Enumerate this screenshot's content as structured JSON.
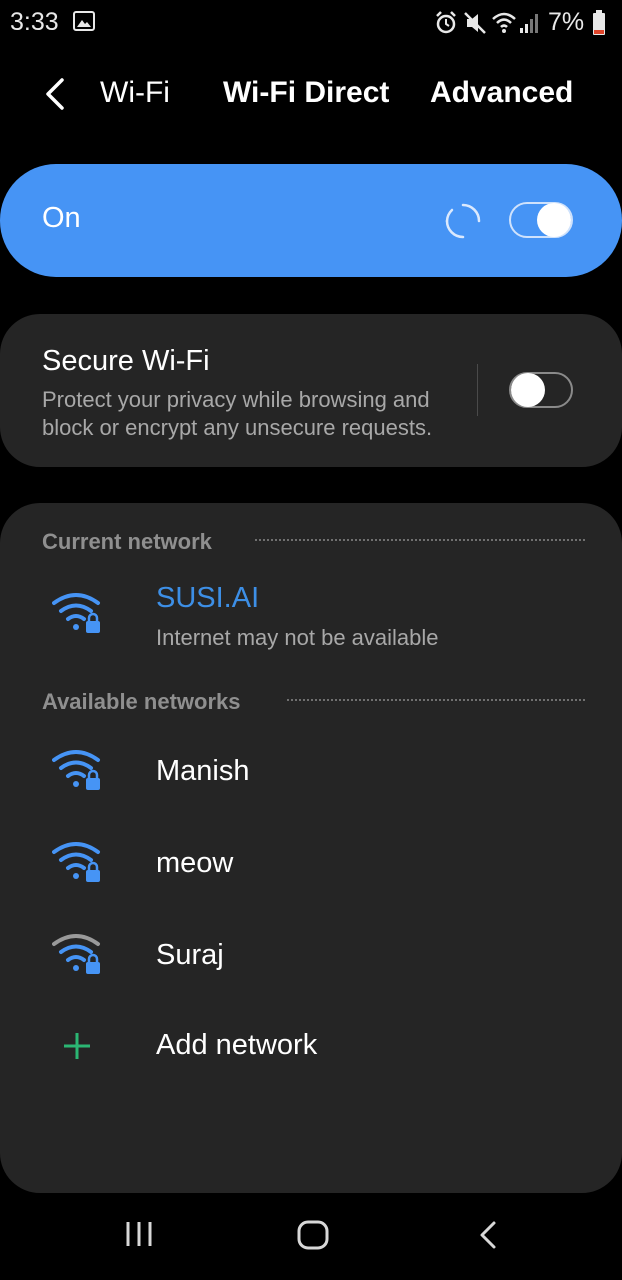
{
  "status_bar": {
    "time": "3:33",
    "battery_percent": "7%",
    "icons": [
      "gallery-icon",
      "alarm-icon",
      "vibrate-icon",
      "wifi-status-icon",
      "signal-icon",
      "battery-icon"
    ]
  },
  "header": {
    "tabs": [
      {
        "label": "Wi-Fi"
      },
      {
        "label": "Wi-Fi Direct"
      },
      {
        "label": "Advanced"
      }
    ]
  },
  "wifi_switch": {
    "label": "On",
    "enabled": true,
    "accent_color": "#4694f5"
  },
  "secure_wifi": {
    "title": "Secure Wi-Fi",
    "description": "Protect your privacy while browsing and block or encrypt any unsecure requests.",
    "enabled": false
  },
  "current_network": {
    "header": "Current network",
    "name": "SUSI.AI",
    "status": "Internet may not be available"
  },
  "available_networks": {
    "header": "Available networks",
    "items": [
      {
        "name": "Manish"
      },
      {
        "name": "meow"
      },
      {
        "name": "Suraj"
      }
    ],
    "add_label": "Add network"
  },
  "bottom_nav": {
    "buttons": [
      "recents-icon",
      "home-icon",
      "back-icon"
    ]
  }
}
